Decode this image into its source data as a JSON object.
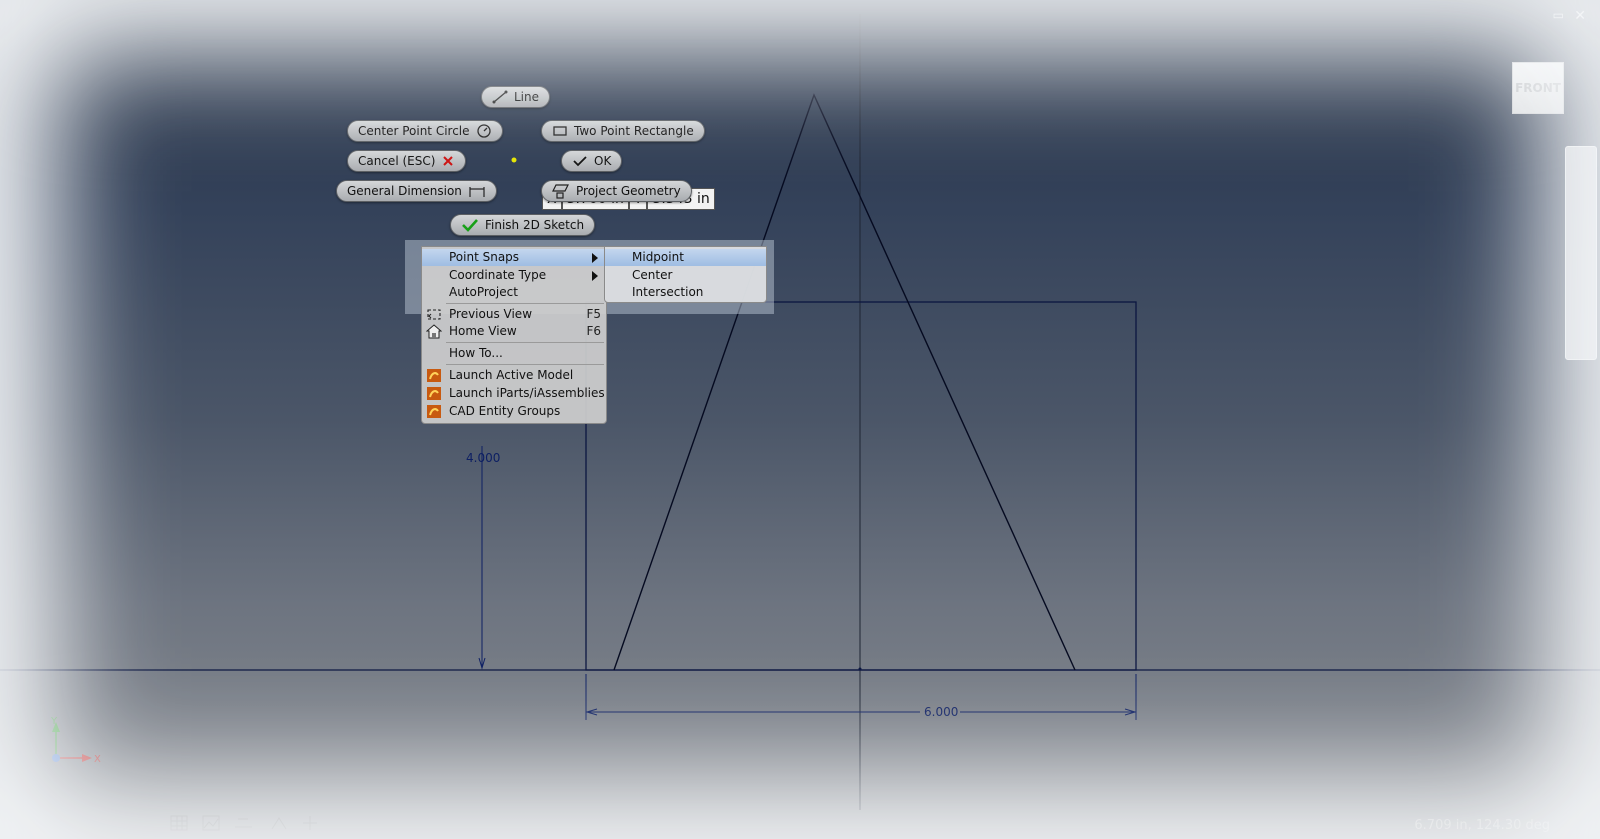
{
  "marking_menu": {
    "line": "Line",
    "center_point_circle": "Center Point Circle",
    "two_point_rectangle": "Two Point Rectangle",
    "cancel": "Cancel (ESC)",
    "ok": "OK",
    "general_dimension": "General Dimension",
    "project_geometry": "Project Geometry",
    "finish_2d_sketch": "Finish 2D Sketch"
  },
  "coordinate_input": {
    "x_label": "X",
    "x_value": "3.700 in",
    "y_label": "Y",
    "y_value": "5.343 in"
  },
  "context_menu": {
    "point_snaps": "Point Snaps",
    "coordinate_type": "Coordinate Type",
    "autoproject": "AutoProject",
    "previous_view": "Previous View",
    "previous_view_shortcut": "F5",
    "home_view": "Home View",
    "home_view_shortcut": "F6",
    "how_to": "How To...",
    "launch_active_model": "Launch Active Model",
    "launch_iparts": "Launch iParts/iAssemblies",
    "cad_entity_groups": "CAD Entity Groups"
  },
  "submenu": {
    "midpoint": "Midpoint",
    "center": "Center",
    "intersection": "Intersection"
  },
  "dimensions": {
    "vertical": "4.000",
    "horizontal": "6.000"
  },
  "viewcube": {
    "label": "FRONT"
  },
  "triad": {
    "x_label": "X",
    "y_label": "Y"
  },
  "status_bar": {
    "text": "6.709 in, 124.30 deg"
  },
  "colors": {
    "sketch_line": "#0b1640",
    "dimension": "#0d1f63",
    "highlight": "#a9c4e8",
    "ok_check": "#18a018",
    "cancel_x": "#cc1111"
  }
}
